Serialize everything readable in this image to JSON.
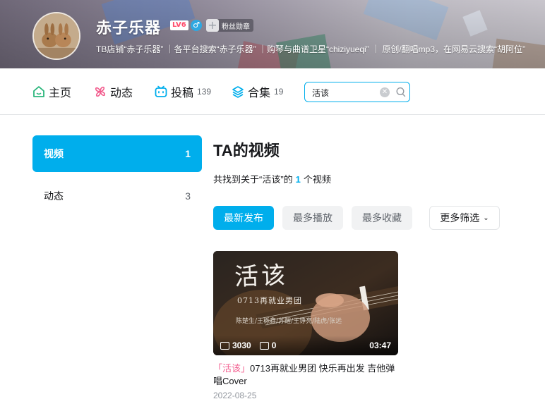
{
  "header": {
    "username": "赤子乐器",
    "level": "LV6",
    "gender_symbol": "♂",
    "fan_badge_label": "粉丝勋章",
    "signature": "TB店铺“赤子乐器” ｜各平台搜索“赤子乐器” ｜购琴与曲谱卫星“chiziyueqi” ｜ 原创/翻唱mp3，在网易云搜索“胡阿位”",
    "avatar_text": "赤子乐器"
  },
  "nav": {
    "home": "主页",
    "dynamic": "动态",
    "videos": "投稿",
    "videos_count": "139",
    "collections": "合集",
    "collections_count": "19"
  },
  "search": {
    "value": "活该"
  },
  "sidebar": {
    "items": [
      {
        "label": "视频",
        "count": "1"
      },
      {
        "label": "动态",
        "count": "3"
      }
    ]
  },
  "main": {
    "title": "TA的视频",
    "result_prefix": "共找到关于“活该”的",
    "result_count": "1",
    "result_suffix": "个视频",
    "sort": {
      "latest": "最新发布",
      "most_played": "最多播放",
      "most_fav": "最多收藏",
      "more": "更多筛选"
    }
  },
  "video": {
    "cover_title": "活该",
    "cover_subtitle": "0713再就业男团",
    "cover_names": "陈楚生/王栎鑫/苏醒/王铮亮/陆虎/张远",
    "plays": "3030",
    "danmaku": "0",
    "duration": "03:47",
    "title_keyword": "活该",
    "title_open": "「",
    "title_close": "」",
    "title_rest": "0713再就业男团 快乐再出发 吉他弹唱Cover",
    "date": "2022-08-25"
  },
  "colors": {
    "accent": "#00aeec",
    "keyword": "#f25d8e"
  }
}
